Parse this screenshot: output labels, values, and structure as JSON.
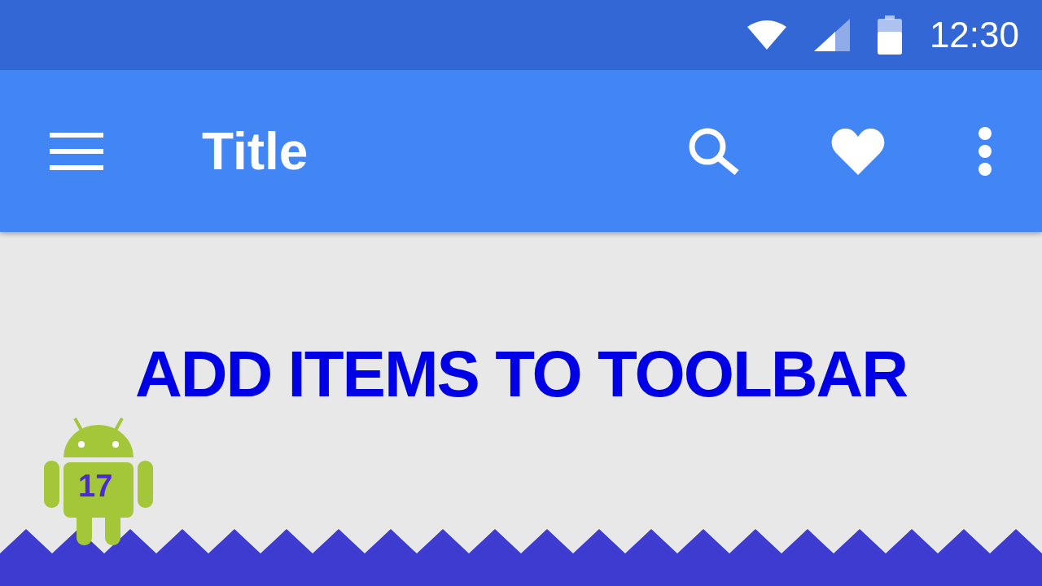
{
  "status_bar": {
    "time": "12:30"
  },
  "toolbar": {
    "title": "Title"
  },
  "headline": "ADD ITEMS TO TOOLBAR",
  "badge": {
    "number": "17"
  }
}
